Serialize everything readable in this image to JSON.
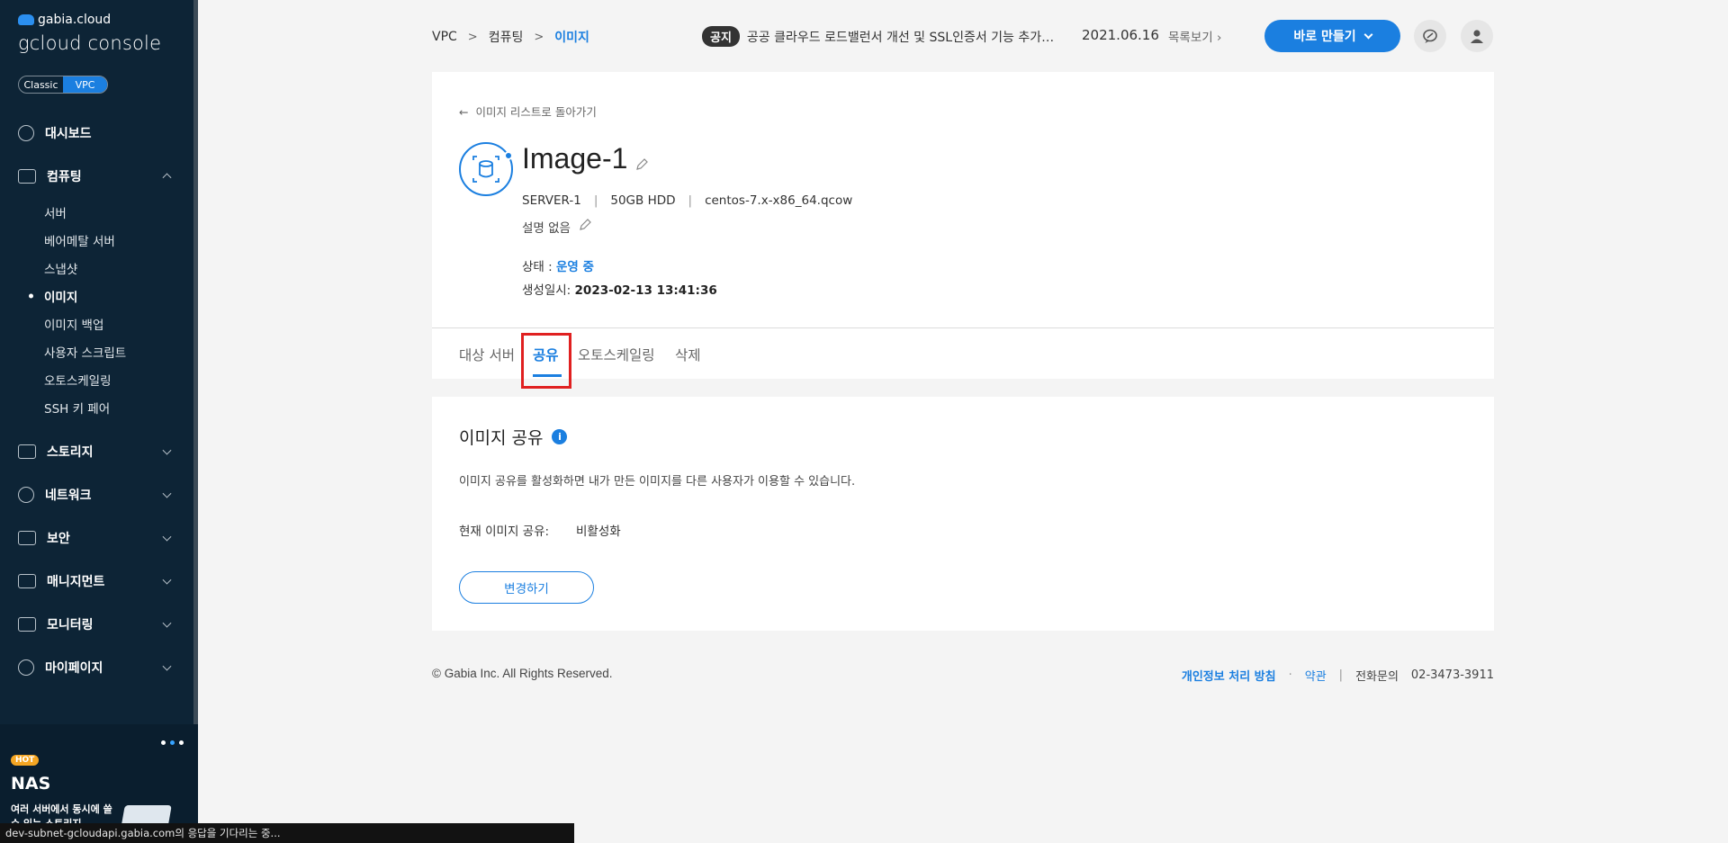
{
  "brand": {
    "top": "gabia.cloud",
    "main": "gcloud console"
  },
  "mode_toggle": {
    "classic": "Classic",
    "vpc": "VPC"
  },
  "nav": {
    "dashboard": "대시보드",
    "computing": "컴퓨팅",
    "computing_sub": [
      "서버",
      "베어메탈 서버",
      "스냅샷",
      "이미지",
      "이미지 백업",
      "사용자 스크립트",
      "오토스케일링",
      "SSH 키 페어"
    ],
    "storage": "스토리지",
    "network": "네트워크",
    "security": "보안",
    "management": "매니지먼트",
    "monitoring": "모니터링",
    "mypage": "마이페이지"
  },
  "promo": {
    "badge": "HOT",
    "title": "NAS",
    "desc": "여러 서버에서 동시에 쓸 수 있는 스토리지"
  },
  "status_bar": "dev-subnet-gcloudapi.gabia.com의 응답을 기다리는 중...",
  "breadcrumb": {
    "item1": "VPC",
    "item2": "컴퓨팅",
    "current": "이미지"
  },
  "notice": {
    "badge": "공지",
    "text": "공공 클라우드 로드밸런서 개선 및 SSL인증서 기능 추가 안내",
    "date": "2021.06.16",
    "list_link": "목록보기"
  },
  "create_button": "바로 만들기",
  "detail": {
    "back_link": "이미지 리스트로 돌아가기",
    "name": "Image-1",
    "server": "SERVER-1",
    "disk": "50GB HDD",
    "os_file": "centos-7.x-x86_64.qcow",
    "description": "설명 없음",
    "state_label": "상태 : ",
    "state_value": "운영 중",
    "created_label": "생성일시: ",
    "created_value": "2023-02-13 13:41:36"
  },
  "tabs": [
    "대상 서버",
    "공유",
    "오토스케일링",
    "삭제"
  ],
  "share": {
    "title": "이미지 공유",
    "description": "이미지 공유를 활성화하면 내가 만든 이미지를 다른 사용자가 이용할 수 있습니다.",
    "status_label": "현재 이미지 공유:",
    "status_value": "비활성화",
    "change_button": "변경하기"
  },
  "footer": {
    "copyright": "© Gabia Inc. All Rights Reserved.",
    "privacy": "개인정보 처리 방침",
    "terms": "약관",
    "phone_label": "전화문의",
    "phone": "02-3473-3911"
  },
  "colors": {
    "accent": "#1b7fe0",
    "sidebar_bg": "#0d2436",
    "highlight": "#e02020"
  }
}
